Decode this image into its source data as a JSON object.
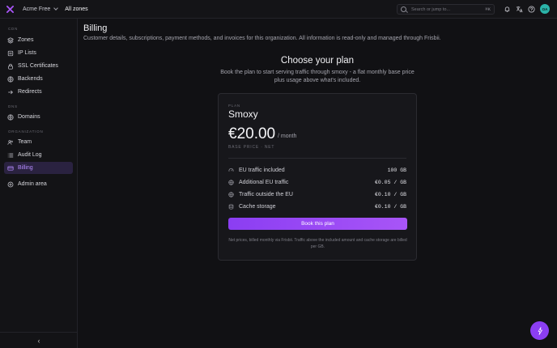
{
  "topbar": {
    "org_label": "Acme Free",
    "zone_crumb": "All zones",
    "search_placeholder": "Search or jump to...",
    "search_shortcut": "⌘K",
    "avatar_initials": "OA"
  },
  "sidebar": {
    "sections": {
      "cdn": "CDN",
      "dns": "DNS",
      "organization": "ORGANIZATION"
    },
    "items": [
      {
        "label": "Zones",
        "icon": "zones-icon"
      },
      {
        "label": "IP Lists",
        "icon": "ip-list-icon"
      },
      {
        "label": "SSL Certificates",
        "icon": "lock-icon"
      },
      {
        "label": "Backends",
        "icon": "globe-icon"
      },
      {
        "label": "Redirects",
        "icon": "redirect-icon"
      },
      {
        "label": "Domains",
        "icon": "globe-icon"
      },
      {
        "label": "Team",
        "icon": "team-icon"
      },
      {
        "label": "Audit Log",
        "icon": "list-icon"
      },
      {
        "label": "Billing",
        "icon": "credit-card-icon",
        "active": true
      },
      {
        "label": "Admin area",
        "icon": "admin-icon"
      }
    ],
    "collapse_label": "‹"
  },
  "main": {
    "title": "Billing",
    "description": "Customer details, subscriptions, payment methods, and invoices for this organization. All information is read-only and managed through Frisbii.",
    "choose_title": "Choose your plan",
    "choose_subtitle": "Book the plan to start serving traffic through smoxy - a flat monthly base price plus usage above what's included."
  },
  "plan": {
    "label": "PLAN",
    "name": "Smoxy",
    "price": "€20.00",
    "period": "/ month",
    "price_note": "BASE PRICE · NET",
    "rows": [
      {
        "label": "EU traffic included",
        "value": "100 GB",
        "icon": "gauge-icon"
      },
      {
        "label": "Additional EU traffic",
        "value": "€0.05 / GB",
        "icon": "globe-icon"
      },
      {
        "label": "Traffic outside the EU",
        "value": "€0.10 / GB",
        "icon": "globe-icon"
      },
      {
        "label": "Cache storage",
        "value": "€0.10 / GB",
        "icon": "database-icon"
      }
    ],
    "book_label": "Book this plan",
    "footnote": "Net prices, billed monthly via Frisbii. Traffic above the included amount and cache storage are billed per GB."
  },
  "colors": {
    "accent": "#a855f7",
    "active_bg": "#2a2240",
    "avatar": "#2bb3a8",
    "background": "#111114"
  }
}
